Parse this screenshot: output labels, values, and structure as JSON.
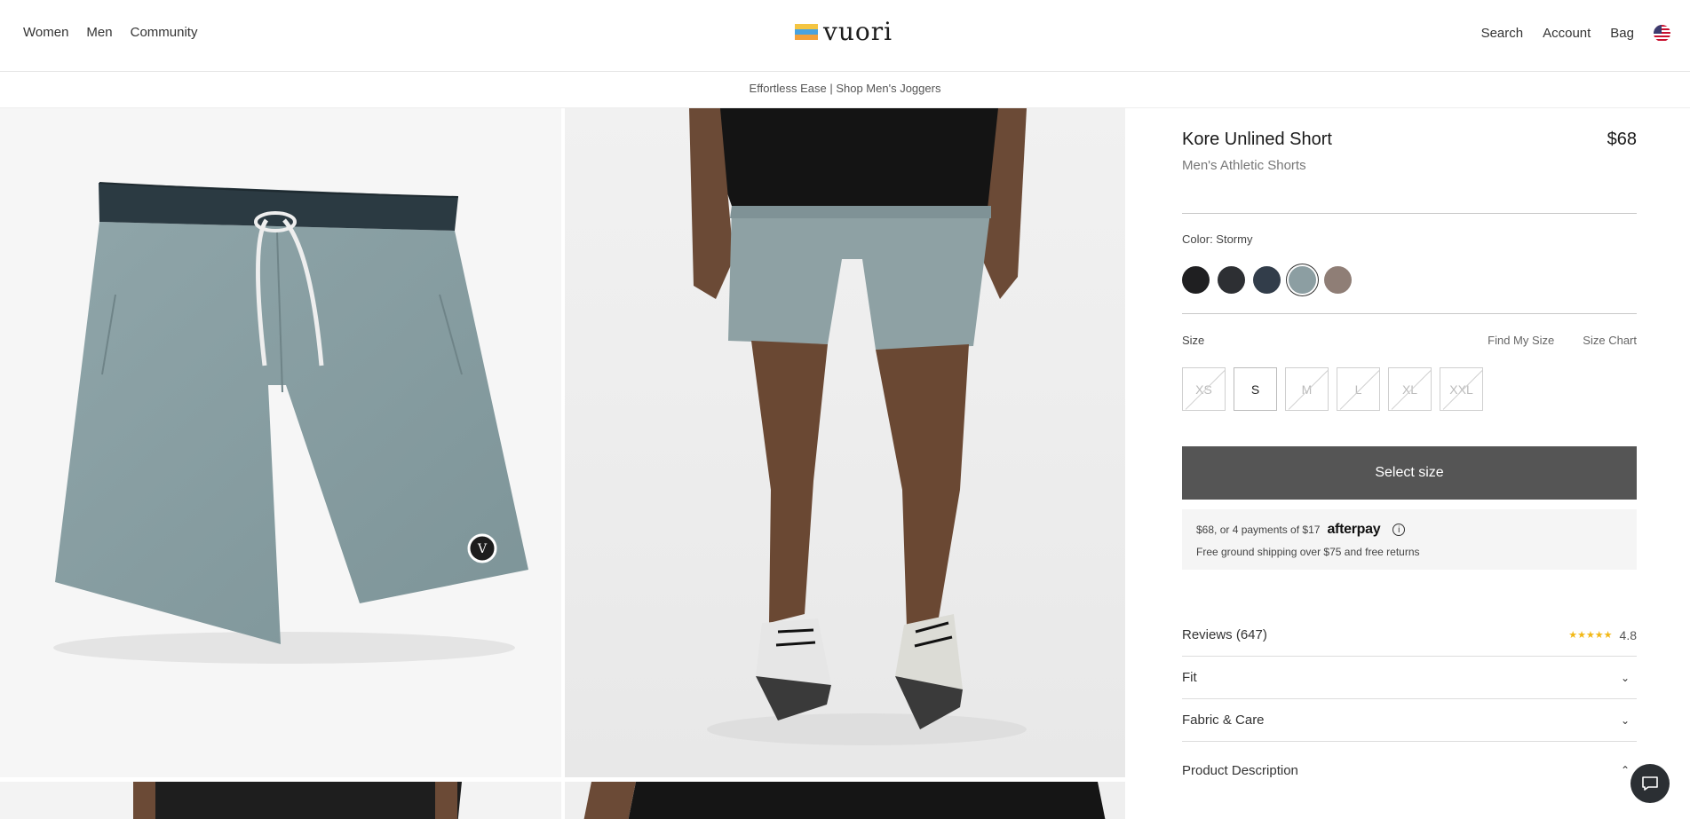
{
  "header": {
    "nav_left": [
      "Women",
      "Men",
      "Community"
    ],
    "logo_text": "vuori",
    "logo_colors": [
      "#f4c542",
      "#4aa3df",
      "#f4a13a"
    ],
    "nav_right": [
      "Search",
      "Account",
      "Bag"
    ]
  },
  "promo": {
    "text": "Effortless Ease | Shop Men's Joggers"
  },
  "product": {
    "title": "Kore Unlined Short",
    "price": "$68",
    "subtitle": "Men's Athletic Shorts",
    "color_label": "Color: Stormy",
    "swatches": [
      {
        "name": "black",
        "color": "#1f1f21"
      },
      {
        "name": "charcoal-heather",
        "color": "#2d2f33"
      },
      {
        "name": "navy",
        "color": "#323d4a"
      },
      {
        "name": "stormy",
        "color": "#8c9ea2",
        "selected": true
      },
      {
        "name": "taupe",
        "color": "#8f7e76"
      }
    ],
    "size_label": "Size",
    "find_my_size": "Find My Size",
    "size_chart": "Size Chart",
    "sizes": [
      {
        "label": "XS",
        "available": false
      },
      {
        "label": "S",
        "available": true
      },
      {
        "label": "M",
        "available": false
      },
      {
        "label": "L",
        "available": false
      },
      {
        "label": "XL",
        "available": false
      },
      {
        "label": "XXL",
        "available": false
      }
    ],
    "cta": "Select size",
    "afterpay_text": "$68, or 4 payments of $17",
    "afterpay_logo": "afterpay",
    "info_glyph": "i",
    "shipping": "Free ground shipping over $75 and free returns",
    "reviews_label": "Reviews (647)",
    "rating": "4.8",
    "stars": "★★★★★",
    "accordions": [
      {
        "label": "Fit",
        "chevron": "⌄"
      },
      {
        "label": "Fabric & Care",
        "chevron": "⌄"
      },
      {
        "label": "Product Description",
        "chevron": "⌃"
      }
    ]
  }
}
